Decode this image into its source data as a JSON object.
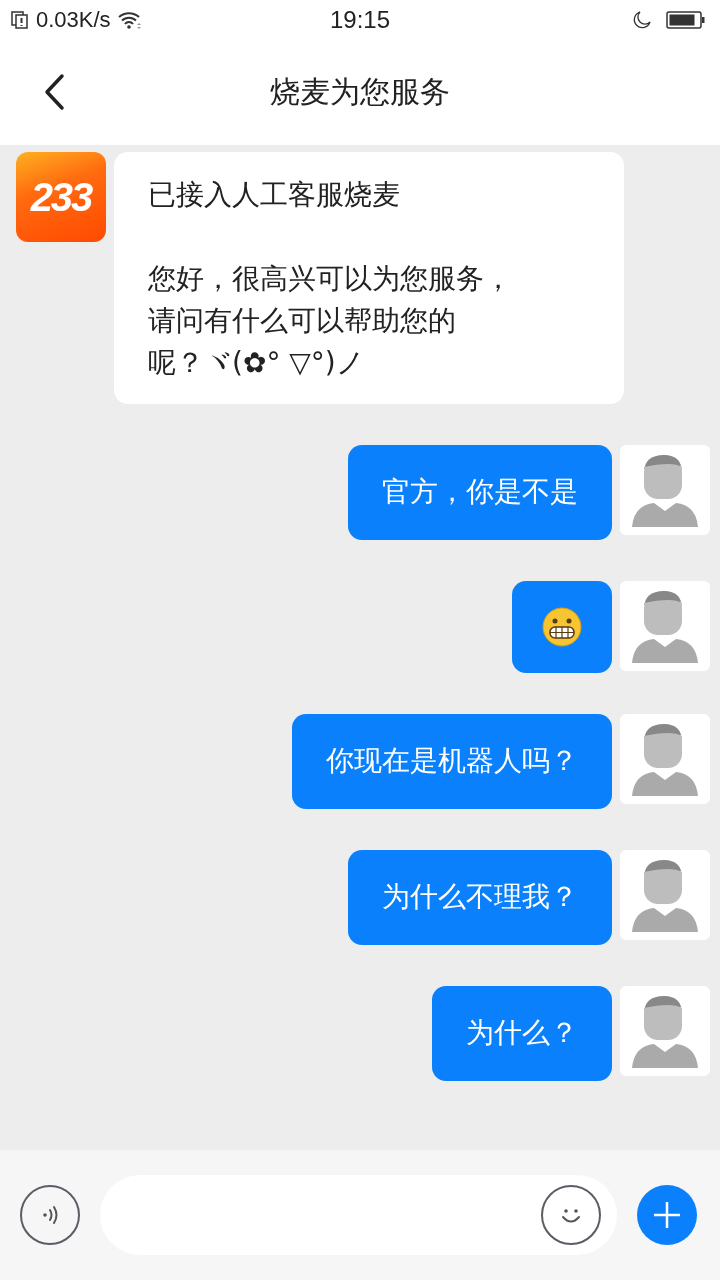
{
  "status_bar": {
    "speed": "0.03K/s",
    "time": "19:15"
  },
  "header": {
    "title": "烧麦为您服务"
  },
  "messages": [
    {
      "kind": "agent_text",
      "avatar_text": "233",
      "paragraphs": [
        [
          "已接入人工客服烧麦"
        ],
        [
          "您好，很高兴可以为您服务，",
          "请问有什么可以帮助您的",
          "呢？ヾ(✿° ▽°)ノ"
        ]
      ]
    },
    {
      "kind": "user_text",
      "text": "官方，你是不是"
    },
    {
      "kind": "user_emoji"
    },
    {
      "kind": "user_text",
      "text": "你现在是机器人吗？"
    },
    {
      "kind": "user_text",
      "text": "为什么不理我？"
    },
    {
      "kind": "user_text",
      "text": "为什么？"
    }
  ]
}
